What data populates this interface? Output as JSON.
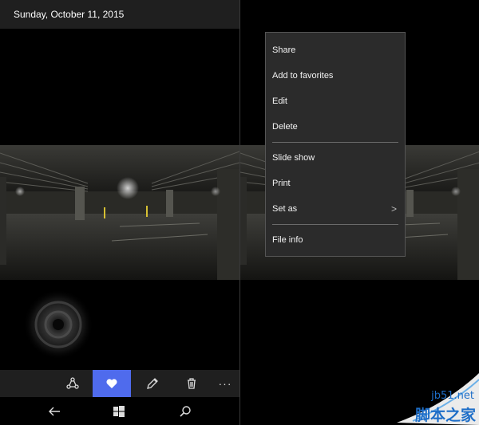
{
  "left": {
    "date": "Sunday, October 11, 2015",
    "appbar": {
      "share_icon": "share-icon",
      "favorite_icon": "heart-icon",
      "edit_icon": "pencil-icon",
      "delete_icon": "trash-icon",
      "more": "···"
    },
    "navbar": {
      "back_icon": "back-arrow-icon",
      "start_icon": "windows-logo-icon",
      "search_icon": "search-icon"
    }
  },
  "context_menu": {
    "items": [
      {
        "label": "Share"
      },
      {
        "label": "Add to favorites"
      },
      {
        "label": "Edit"
      },
      {
        "label": "Delete"
      },
      {
        "label": "Slide show"
      },
      {
        "label": "Print"
      },
      {
        "label": "Set as"
      },
      {
        "label": "File info"
      }
    ],
    "submenu_chevron": ">"
  },
  "watermark": {
    "site": "jb51.net",
    "name": "脚本之家"
  },
  "colors": {
    "accent": "#4f6bed",
    "bar": "#1f1f1f",
    "menu_bg": "#2b2b2b"
  }
}
